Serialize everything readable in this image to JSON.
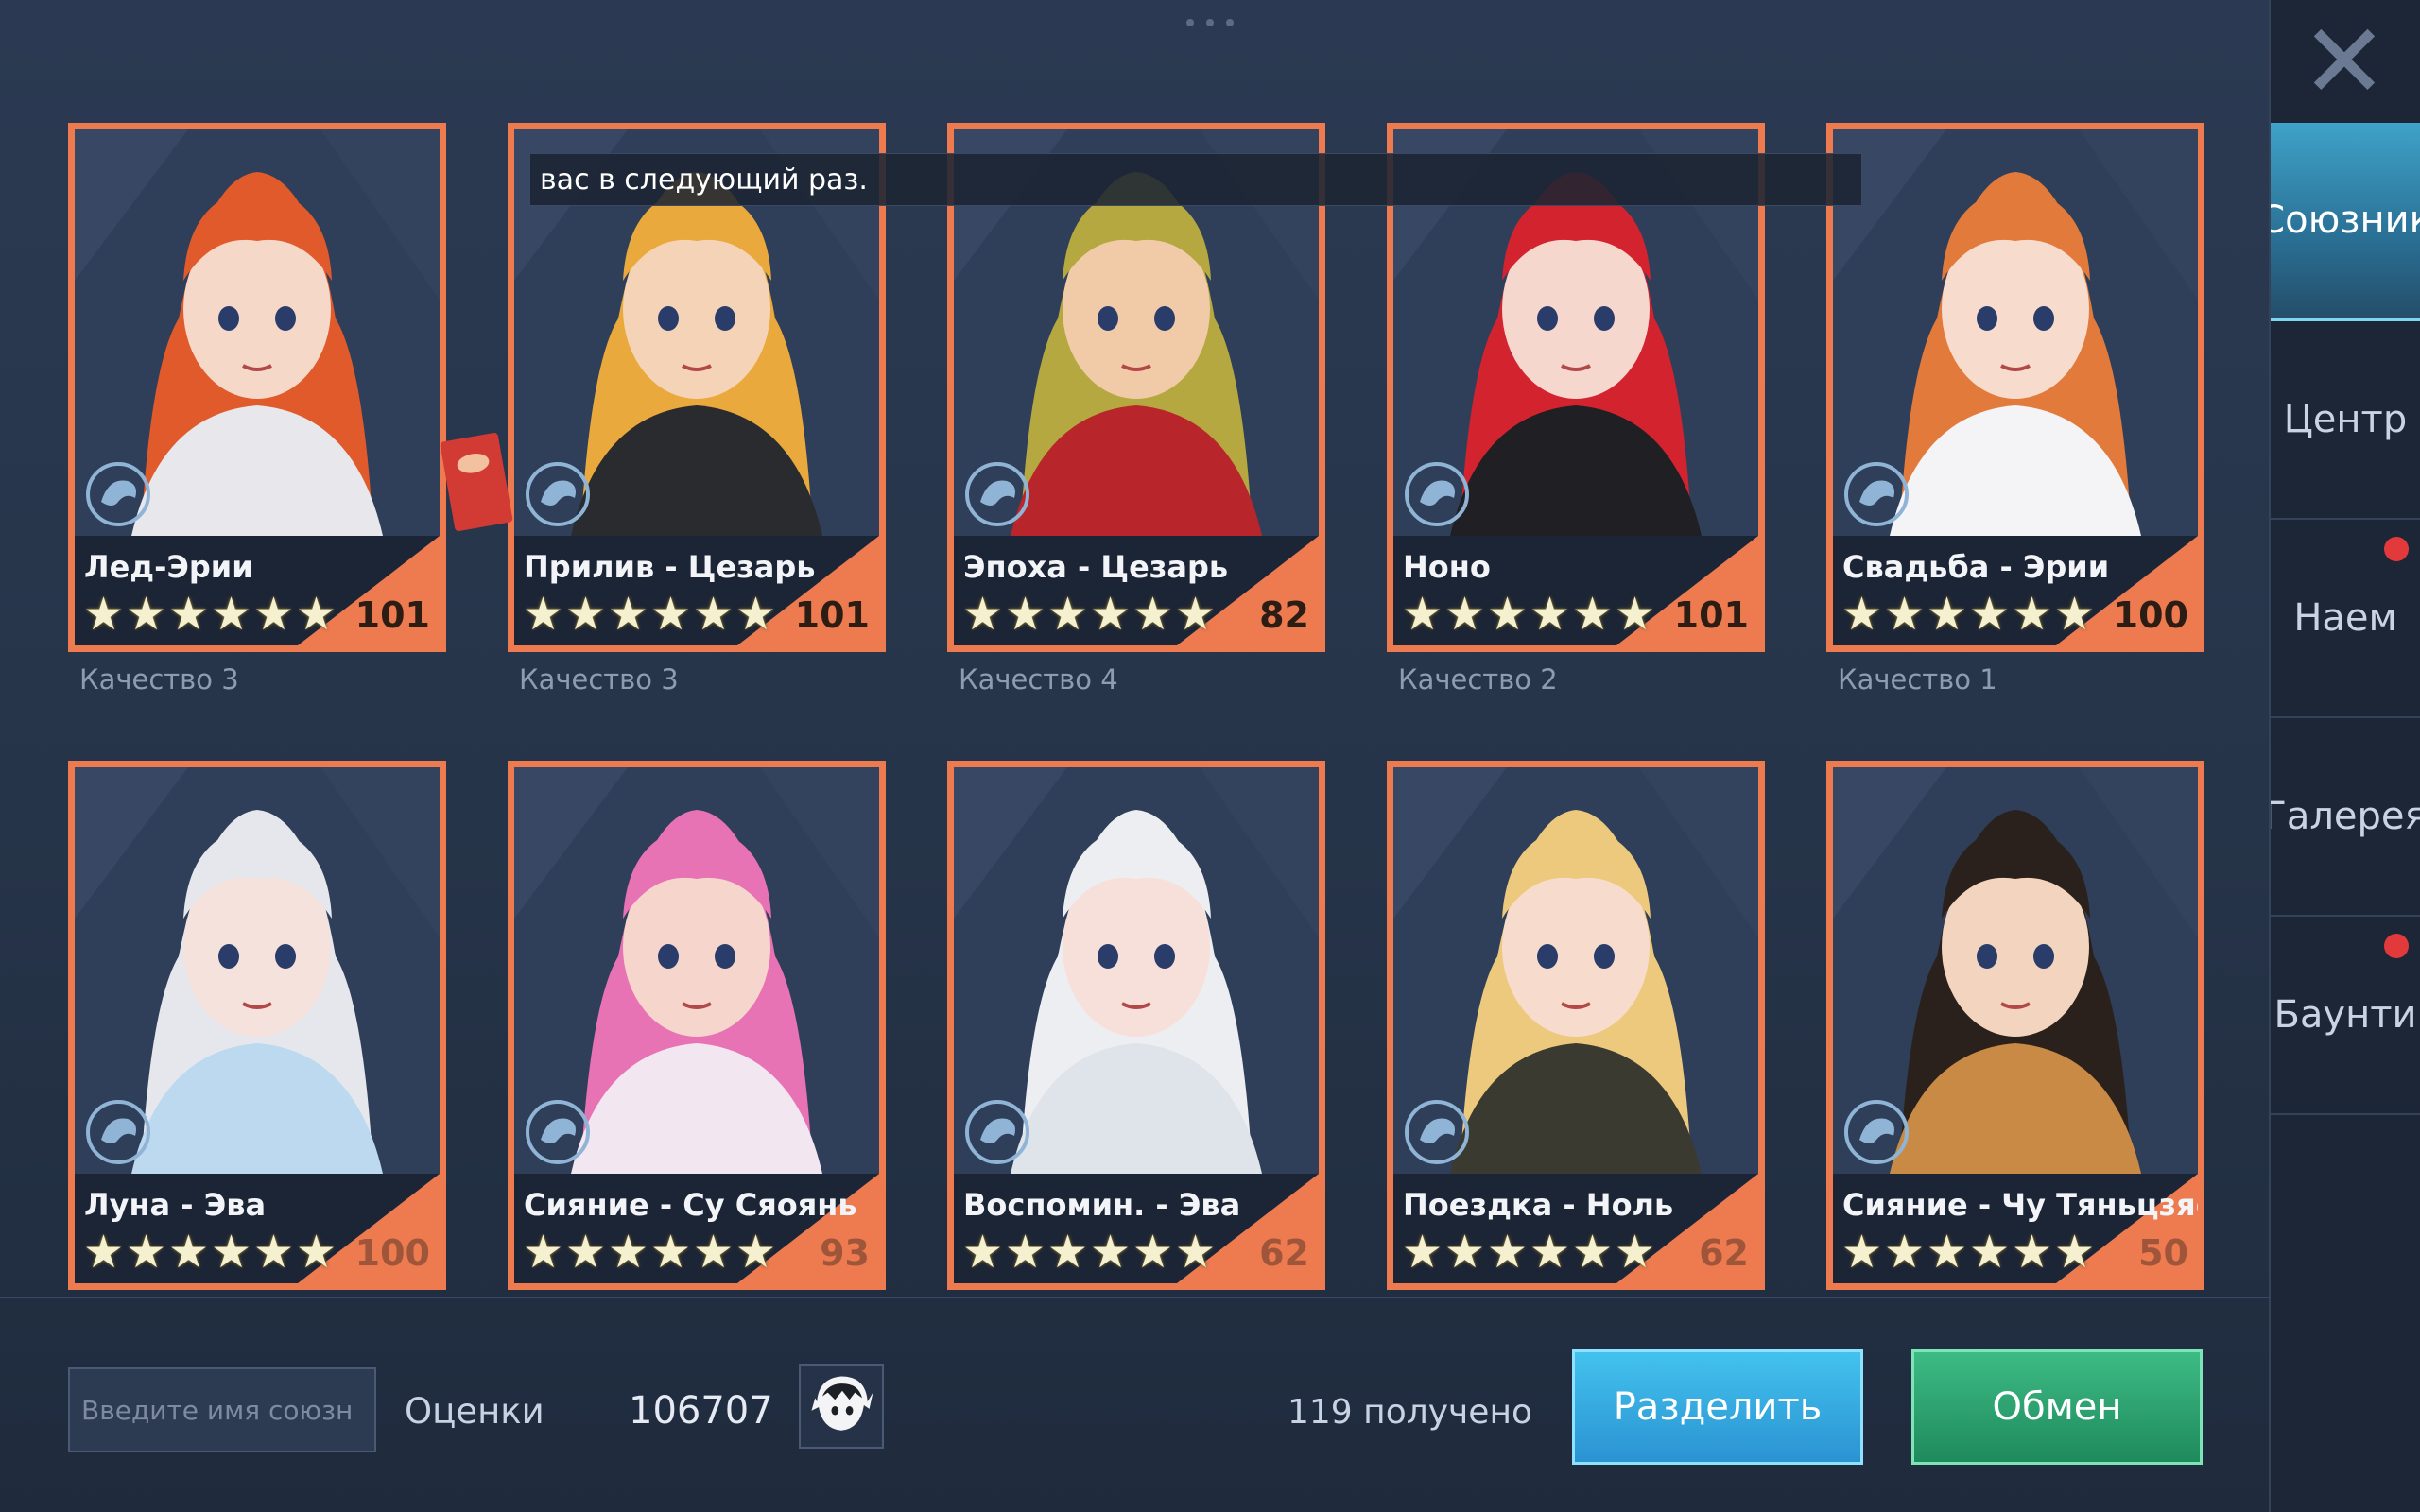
{
  "notification": "вас в следующий раз.",
  "nav": {
    "close_icon": "close-icon",
    "items": [
      {
        "label": "Союзник",
        "active": true,
        "badge": false
      },
      {
        "label": "Центр",
        "active": false,
        "badge": false
      },
      {
        "label": "Наем",
        "active": false,
        "badge": true
      },
      {
        "label": "Галерея",
        "active": false,
        "badge": false
      },
      {
        "label": "Баунти",
        "active": false,
        "badge": true
      }
    ]
  },
  "cards": [
    {
      "name": "Лед-Эрии",
      "stars": "★★★★★★",
      "level": "101",
      "quality": "Качество 3",
      "hair": "#e05a2c",
      "skin": "#f6d8c8",
      "outfit": "#e8e8ec"
    },
    {
      "name": "Прилив - Цезарь",
      "stars": "★★★★★★",
      "level": "101",
      "quality": "Качество 3",
      "hair": "#e9a93c",
      "skin": "#f5d3b6",
      "outfit": "#2a2b2f"
    },
    {
      "name": "Эпоха - Цезарь",
      "stars": "★★★★★★",
      "level": "82",
      "quality": "Качество 4",
      "hair": "#b6a840",
      "skin": "#f1cba8",
      "outfit": "#b8252a"
    },
    {
      "name": "Ноно",
      "stars": "★★★★★★",
      "level": "101",
      "quality": "Качество 2",
      "hair": "#d3232f",
      "skin": "#f5d7cd",
      "outfit": "#202024"
    },
    {
      "name": "Свадьба - Эрии",
      "stars": "★★★★★★",
      "level": "100",
      "quality": "Качество 1",
      "hair": "#e27a3c",
      "skin": "#f7dccd",
      "outfit": "#f4f4f7"
    },
    {
      "name": "Луна - Эва",
      "stars": "★★★★★★",
      "level": "100",
      "quality": "",
      "hair": "#e6e7ec",
      "skin": "#f6e2dc",
      "outfit": "#bcd9ef"
    },
    {
      "name": "Сияние - Су Сяоянь",
      "stars": "★★★★★★",
      "level": "93",
      "quality": "",
      "hair": "#e873b4",
      "skin": "#f6d6cc",
      "outfit": "#f2e6f0"
    },
    {
      "name": "Воспомин. - Эва",
      "stars": "★★★★★★",
      "level": "62",
      "quality": "",
      "hair": "#eceef2",
      "skin": "#f7e0da",
      "outfit": "#dfe3ea"
    },
    {
      "name": "Поездка - Ноль",
      "stars": "★★★★★★",
      "level": "62",
      "quality": "",
      "hair": "#ecc97c",
      "skin": "#f7dccd",
      "outfit": "#3b3a30"
    },
    {
      "name": "Сияние - Чу Тяньцзяо",
      "stars": "★★★★★★",
      "level": "50",
      "quality": "",
      "hair": "#2b211c",
      "skin": "#f3d5bf",
      "outfit": "#c98a45"
    }
  ],
  "bottom": {
    "search_placeholder": "Введите имя союзн",
    "rating_label": "Оценки",
    "rating_value": "106707",
    "received": "119 получено",
    "split_label": "Разделить",
    "exchange_label": "Обмен"
  }
}
